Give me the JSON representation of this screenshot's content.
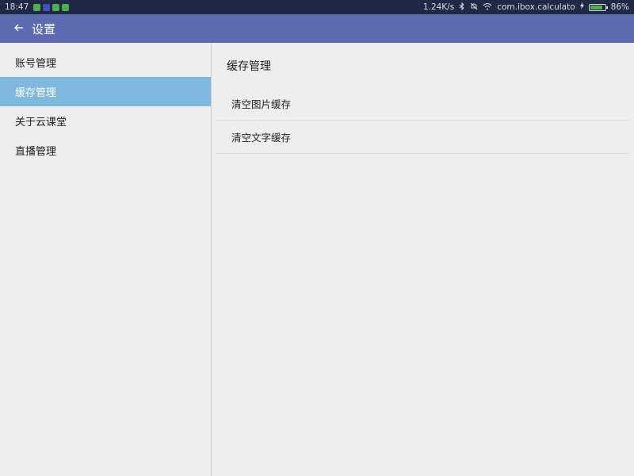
{
  "status_bar": {
    "time": "18:47",
    "network_speed": "1.24K/s",
    "app_name": "com.ibox.calculato",
    "battery_percent": "86%",
    "battery_level": 0.86,
    "notif_colors": [
      "#4caf50",
      "#3f51b5",
      "#4caf50",
      "#4caf50"
    ]
  },
  "toolbar": {
    "back_icon": "arrow-left-icon",
    "title": "设置"
  },
  "sidebar": {
    "items": [
      {
        "label": "账号管理",
        "active": false
      },
      {
        "label": "缓存管理",
        "active": true
      },
      {
        "label": "关于云课堂",
        "active": false
      },
      {
        "label": "直播管理",
        "active": false
      }
    ]
  },
  "content": {
    "section_title": "缓存管理",
    "items": [
      {
        "label": "清空图片缓存"
      },
      {
        "label": "清空文字缓存"
      }
    ]
  },
  "colors": {
    "status_bar_bg": "#1f2945",
    "toolbar_bg": "#5c6bb1",
    "active_item_bg": "#80b9df"
  }
}
